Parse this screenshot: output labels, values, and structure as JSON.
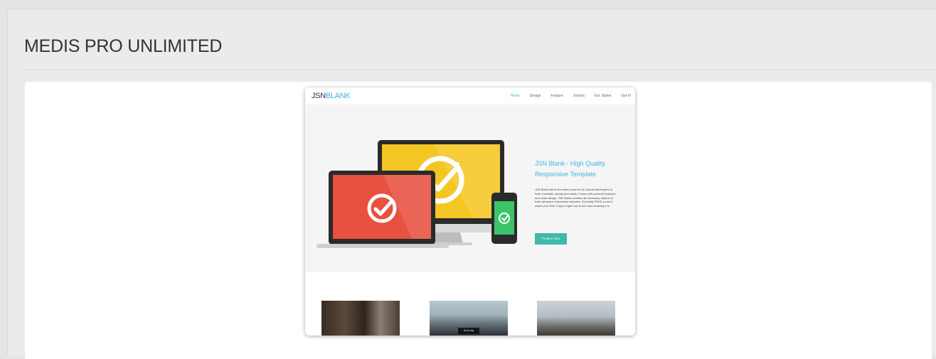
{
  "page": {
    "title": "MEDIS PRO UNLIMITED"
  },
  "preview": {
    "logo_prefix": "JSN",
    "logo_suffix": "BLANK",
    "nav": [
      "Home",
      "Design",
      "Feature",
      "Joomla",
      "Ext. Styles",
      "Get It!"
    ],
    "hero_title": "JSN Blank - High Quality Responsive Template",
    "hero_text": "JSN Blank will be the best choice for all Joomla developers to build a website quickly and easily. Comes with powerful features and clean design. JSN Blank contains all necessary options to build awesome responsive websites. It's totally FREE so don't waste your time. Enjoy it right now to see how amazing it is.",
    "button_label": "Product Tour",
    "thumb_label": "Go to top"
  },
  "colors": {
    "accent_blue": "#3fb4e0",
    "button_teal": "#3fb9a8",
    "laptop_screen": "#e8503f",
    "monitor_screen": "#f4c623",
    "phone_screen": "#3cc46a"
  }
}
